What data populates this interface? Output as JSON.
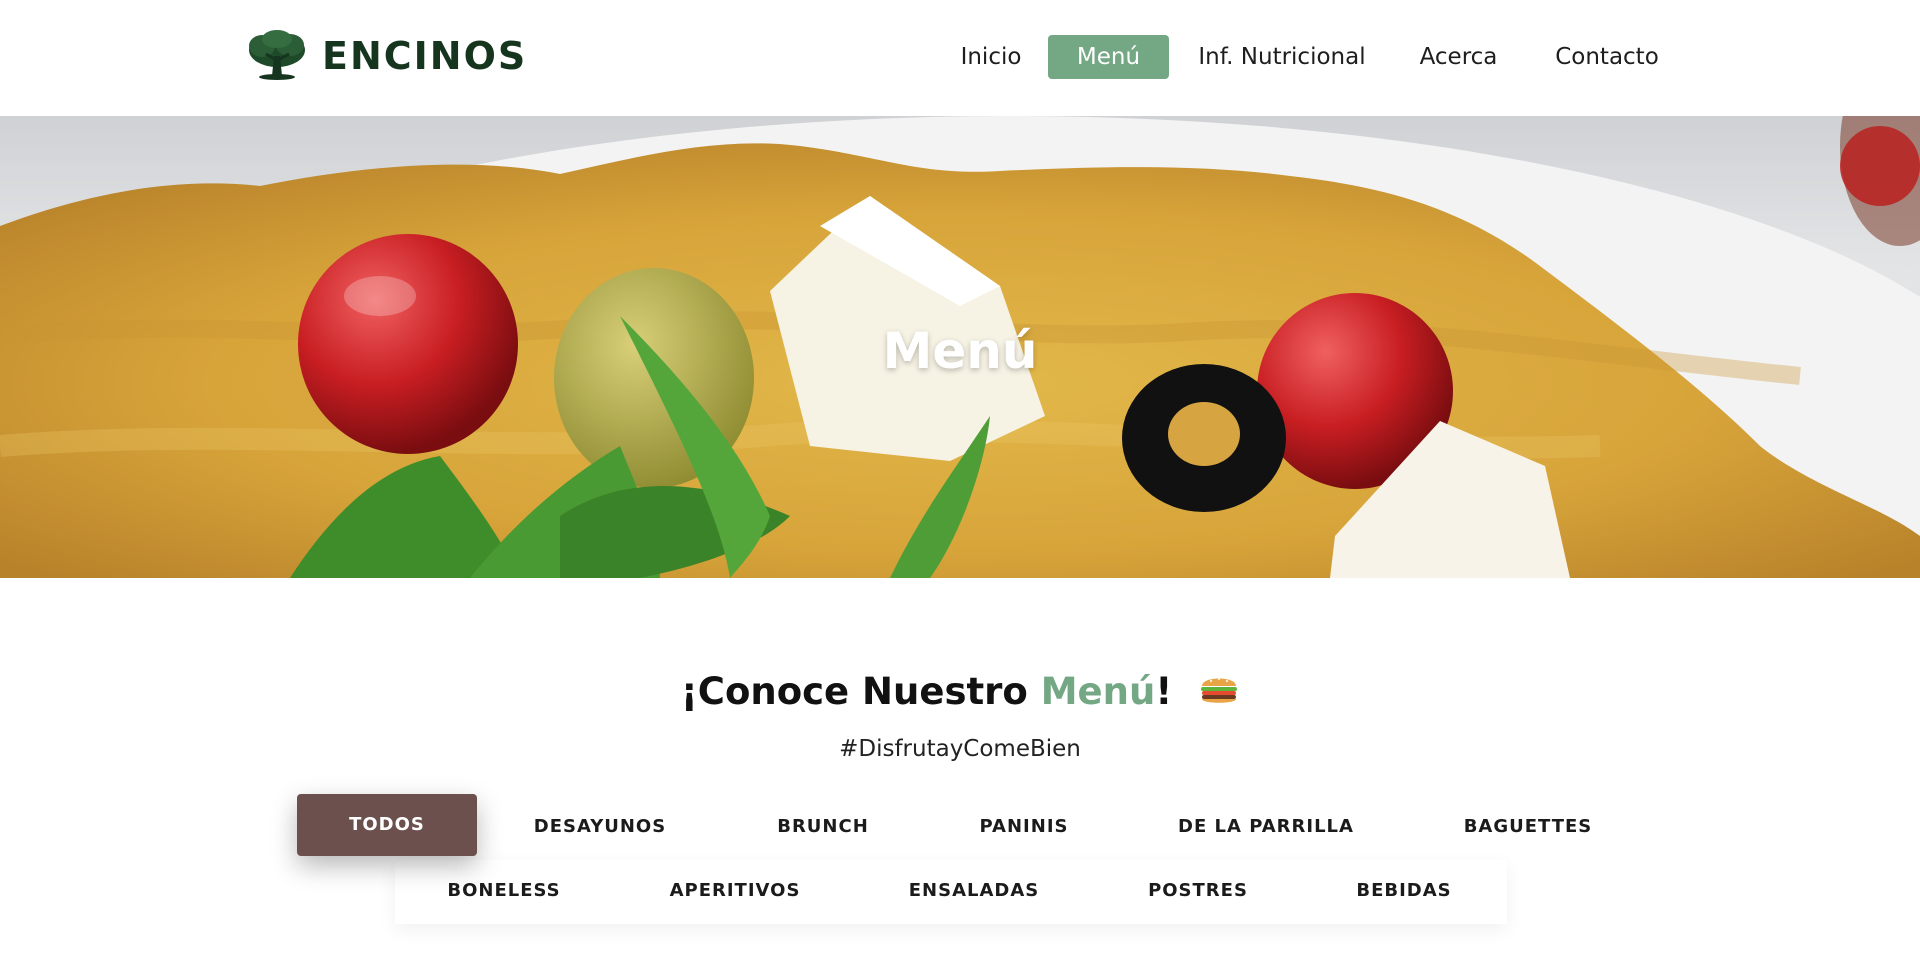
{
  "header": {
    "logo_text": "ENCINOS",
    "nav": [
      {
        "label": "Inicio",
        "active": false
      },
      {
        "label": "Menú",
        "active": true
      },
      {
        "label": "Inf. Nutricional",
        "active": false
      },
      {
        "label": "Acerca",
        "active": false
      },
      {
        "label": "Contacto",
        "active": false
      }
    ]
  },
  "hero": {
    "title": "Menú"
  },
  "menu_section": {
    "heading_prefix": "¡Conoce Nuestro ",
    "heading_accent": "Menú",
    "heading_suffix": "!",
    "heading_icon": "burger-icon",
    "tagline": "#DisfrutayComeBien"
  },
  "filters": [
    {
      "label": "TODOS",
      "active": true
    },
    {
      "label": "DESAYUNOS",
      "active": false
    },
    {
      "label": "BRUNCH",
      "active": false
    },
    {
      "label": "PANINIS",
      "active": false
    },
    {
      "label": "DE LA PARRILLA",
      "active": false
    },
    {
      "label": "BAGUETTES",
      "active": false
    },
    {
      "label": "BONELESS",
      "active": false
    },
    {
      "label": "APERITIVOS",
      "active": false
    },
    {
      "label": "ENSALADAS",
      "active": false
    },
    {
      "label": "POSTRES",
      "active": false
    },
    {
      "label": "BEBIDAS",
      "active": false
    }
  ],
  "colors": {
    "accent_green": "#74a784",
    "active_filter": "#6b504d",
    "logo_green": "#16351f"
  }
}
